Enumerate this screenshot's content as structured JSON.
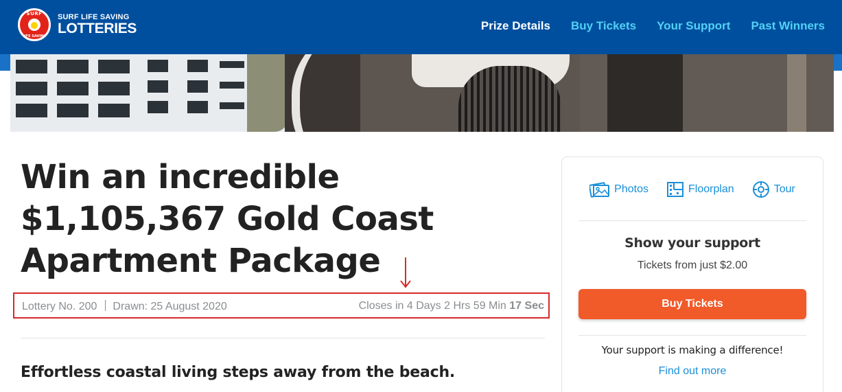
{
  "header": {
    "logo": {
      "top": "SURF LIFE SAVING",
      "bottom": "LOTTERIES",
      "badge_top": "SURF",
      "badge_bottom": "LIFE SAVING"
    },
    "nav": [
      {
        "label": "Prize Details",
        "active": true
      },
      {
        "label": "Buy Tickets",
        "active": false
      },
      {
        "label": "Your Support",
        "active": false
      },
      {
        "label": "Past Winners",
        "active": false
      }
    ]
  },
  "prize": {
    "title": "Win an incredible $1,105,367 Gold Coast Apartment Package",
    "lottery_no": "Lottery No. 200",
    "drawn": "Drawn: 25 August 2020",
    "closes_prefix": "Closes in",
    "countdown": {
      "days": "4 Days",
      "hrs": "2 Hrs",
      "min": "59 Min",
      "sec": "17 Sec"
    },
    "subheading": "Effortless coastal living steps away from the beach."
  },
  "card": {
    "media": [
      {
        "label": "Photos",
        "icon": "photos-icon"
      },
      {
        "label": "Floorplan",
        "icon": "floorplan-icon"
      },
      {
        "label": "Tour",
        "icon": "tour-icon"
      }
    ],
    "support_title": "Show your support",
    "support_sub": "Tickets from just $2.00",
    "buy_button": "Buy Tickets",
    "difference_text": "Your support is making a difference!",
    "find_out_more": "Find out more"
  },
  "colors": {
    "header_bg": "#004f9f",
    "nav_link": "#52d1f5",
    "nav_active": "#ffffff",
    "cta": "#f15a29",
    "link": "#1a8fd8",
    "annotation": "#d62a2a"
  }
}
